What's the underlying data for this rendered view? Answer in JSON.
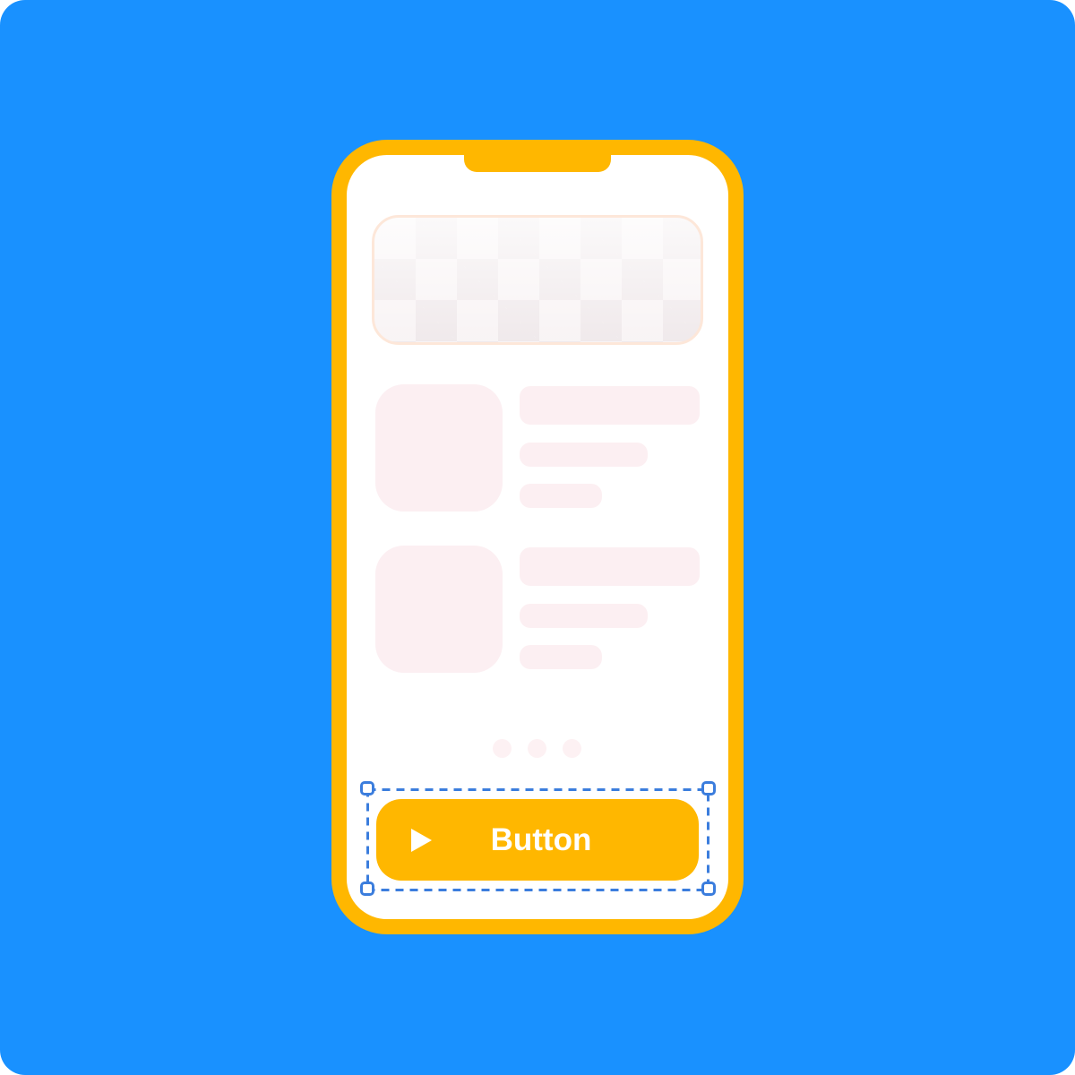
{
  "colors": {
    "background": "#1991FF",
    "phone_frame": "#FFB700",
    "placeholder": "#FCEFF2",
    "selection": "#3B7DDD",
    "button": "#FFB700",
    "button_text": "#FFFFFF"
  },
  "screen": {
    "banner": {
      "type": "image-placeholder"
    },
    "list_items": [
      {
        "thumbnail": "image-placeholder",
        "text_lines": 3
      },
      {
        "thumbnail": "image-placeholder",
        "text_lines": 3
      }
    ],
    "pagination": {
      "dot_count": 3
    }
  },
  "cta_button": {
    "label": "Button",
    "icon": "play-icon",
    "selected": true
  }
}
